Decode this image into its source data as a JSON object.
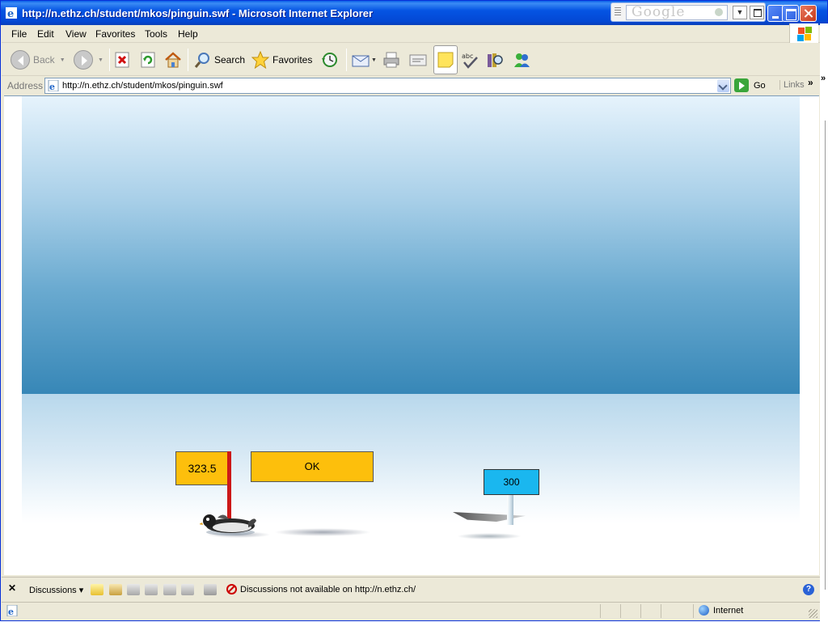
{
  "window": {
    "title": "http://n.ethz.ch/student/mkos/pinguin.swf - Microsoft Internet Explorer",
    "google_text": "Google"
  },
  "menu": [
    "File",
    "Edit",
    "View",
    "Favorites",
    "Tools",
    "Help"
  ],
  "toolbar": {
    "back_label": "Back",
    "search_label": "Search",
    "favorites_label": "Favorites"
  },
  "address": {
    "label": "Address",
    "url": "http://n.ethz.ch/student/mkos/pinguin.swf",
    "go_label": "Go",
    "links_label": "Links"
  },
  "game": {
    "distance_value": "323.5",
    "ok_label": "OK",
    "target_marker": "300"
  },
  "discussions": {
    "label": "Discussions",
    "message": "Discussions not available on http://n.ethz.ch/"
  },
  "status": {
    "zone": "Internet"
  },
  "colors": {
    "sign_yellow": "#fdbf0c",
    "sign_blue": "#1ab7ef",
    "pole_red": "#cc1818",
    "sky_bottom": "#3787b7"
  }
}
